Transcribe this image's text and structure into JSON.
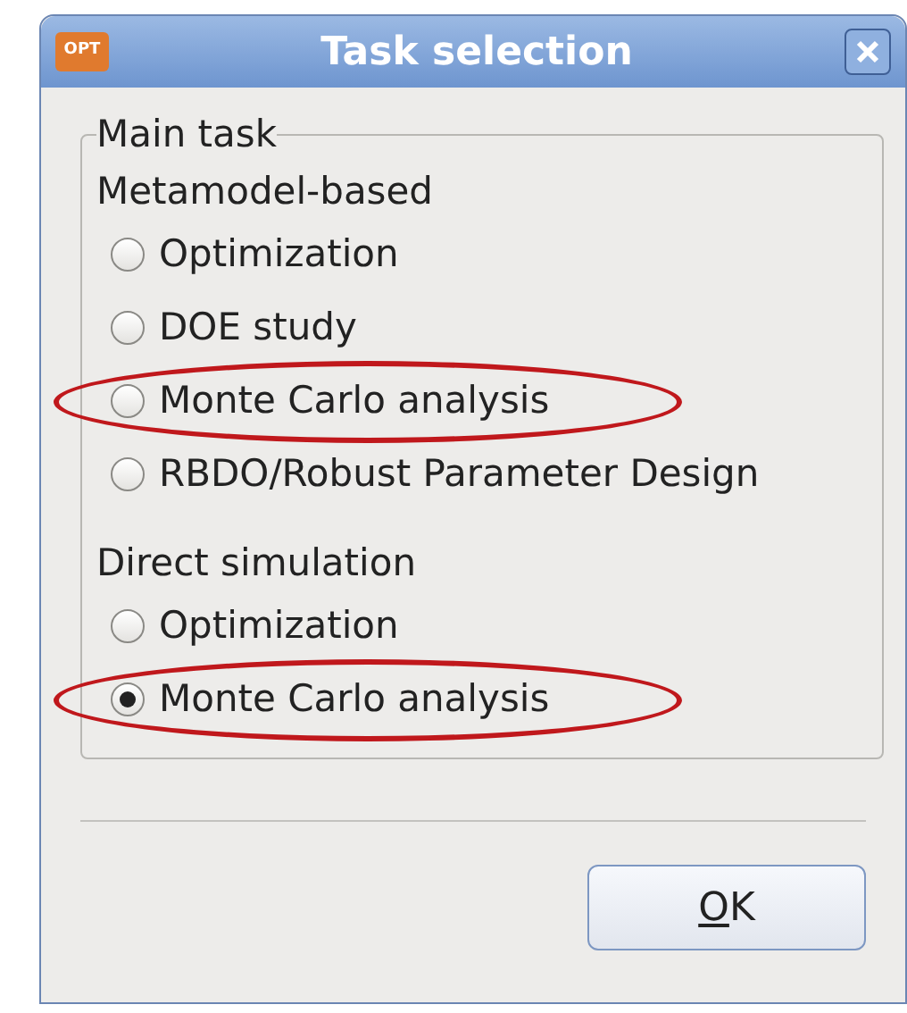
{
  "window": {
    "title": "Task selection",
    "app_icon_text": "OPT"
  },
  "group": {
    "title": "Main task",
    "sections": [
      {
        "heading": "Metamodel-based",
        "options": [
          {
            "label": "Optimization",
            "selected": false,
            "highlighted": false
          },
          {
            "label": "DOE study",
            "selected": false,
            "highlighted": false
          },
          {
            "label": "Monte Carlo analysis",
            "selected": false,
            "highlighted": true
          },
          {
            "label": "RBDO/Robust Parameter Design",
            "selected": false,
            "highlighted": false
          }
        ]
      },
      {
        "heading": "Direct simulation",
        "options": [
          {
            "label": "Optimization",
            "selected": false,
            "highlighted": false
          },
          {
            "label": "Monte Carlo analysis",
            "selected": true,
            "highlighted": true
          }
        ]
      }
    ]
  },
  "buttons": [
    {
      "label": "OK",
      "mnemonic": true
    }
  ]
}
